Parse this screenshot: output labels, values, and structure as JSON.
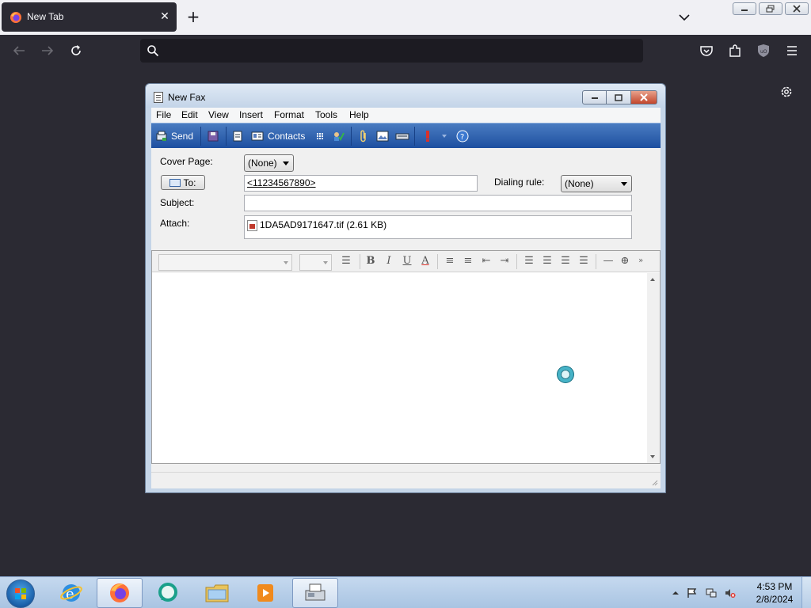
{
  "browser": {
    "tab": {
      "title": "New Tab"
    },
    "urlbar": {
      "value": "",
      "placeholder": ""
    }
  },
  "fax": {
    "title": "New Fax",
    "menu": [
      "File",
      "Edit",
      "View",
      "Insert",
      "Format",
      "Tools",
      "Help"
    ],
    "toolbar": {
      "send_label": "Send",
      "contacts_label": "Contacts"
    },
    "form": {
      "cover_page_label": "Cover Page:",
      "cover_page_value": "(None)",
      "to_button_label": "To:",
      "to_value": "<11234567890>",
      "dialing_rule_label": "Dialing rule:",
      "dialing_rule_value": "(None)",
      "subject_label": "Subject:",
      "subject_value": "",
      "attach_label": "Attach:",
      "attachment": "1DA5AD9171647.tif (2.61 KB)"
    },
    "format_toolbar": {
      "font_name": "",
      "font_size": "",
      "icons": [
        "line-spacing-icon",
        "bold-icon",
        "italic-icon",
        "underline-icon",
        "font-color-icon",
        "numbered-list-icon",
        "bullet-list-icon",
        "decrease-indent-icon",
        "increase-indent-icon",
        "align-left-icon",
        "align-center-icon",
        "align-right-icon",
        "justify-icon",
        "horizontal-line-icon",
        "insert-picture-icon",
        "more-icon"
      ]
    }
  },
  "taskbar": {
    "apps": [
      "internet-explorer",
      "firefox",
      "unknown-app",
      "windows-explorer",
      "media-player",
      "fax-and-scan"
    ],
    "clock": {
      "time": "4:53 PM",
      "date": "2/8/2024"
    }
  },
  "colors": {
    "firefox_dark": "#2b2a33",
    "toolbar_blue": "#1d4fa0",
    "taskbar_blue": "#a9c4e2"
  }
}
